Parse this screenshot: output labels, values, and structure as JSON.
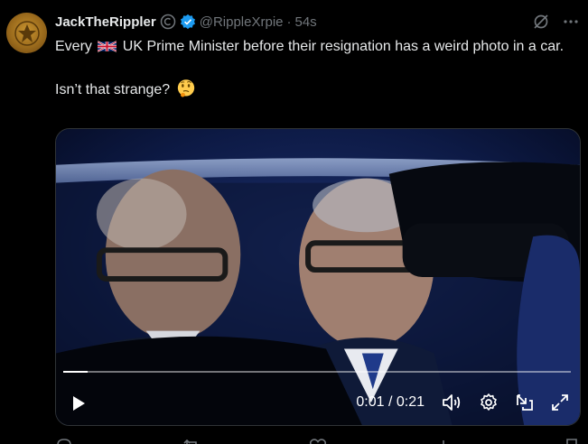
{
  "tweet": {
    "author_name": "JackTheRippler",
    "handle": "@RippleXrpie",
    "separator": "·",
    "time": "54s",
    "line1_before_flag": "Every ",
    "line1_after_flag": " UK Prime Minister before their resignation has a weird photo in a car.",
    "line2": "Isn’t that strange? ",
    "flag_icon": "uk-flag-icon",
    "emoji_icon": "thinking-face-icon"
  },
  "video": {
    "current_time": "0:01",
    "time_separator": " / ",
    "duration": "0:21",
    "progress_fraction": 0.048
  },
  "colors": {
    "background": "#000000",
    "text": "#e7e9ea",
    "muted": "#71767b",
    "verified": "#1d9bf0"
  }
}
